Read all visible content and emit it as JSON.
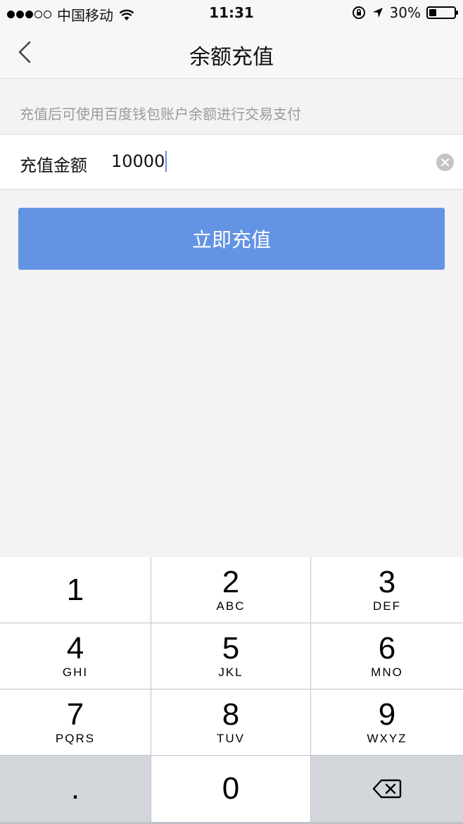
{
  "status_bar": {
    "carrier": "中国移动",
    "time": "11:31",
    "battery_text": "30%",
    "battery_level": 0.3
  },
  "nav": {
    "title": "余额充值"
  },
  "hint": "充值后可使用百度钱包账户余额进行交易支付",
  "amount": {
    "label": "充值金额",
    "value": "10000"
  },
  "submit_label": "立即充值",
  "keyboard": {
    "keys": [
      {
        "num": "1",
        "letters": ""
      },
      {
        "num": "2",
        "letters": "ABC"
      },
      {
        "num": "3",
        "letters": "DEF"
      },
      {
        "num": "4",
        "letters": "GHI"
      },
      {
        "num": "5",
        "letters": "JKL"
      },
      {
        "num": "6",
        "letters": "MNO"
      },
      {
        "num": "7",
        "letters": "PQRS"
      },
      {
        "num": "8",
        "letters": "TUV"
      },
      {
        "num": "9",
        "letters": "WXYZ"
      },
      {
        "num": ".",
        "letters": ""
      },
      {
        "num": "0",
        "letters": ""
      }
    ]
  },
  "colors": {
    "primary_button": "#6393e3",
    "background": "#f3f3f5"
  }
}
